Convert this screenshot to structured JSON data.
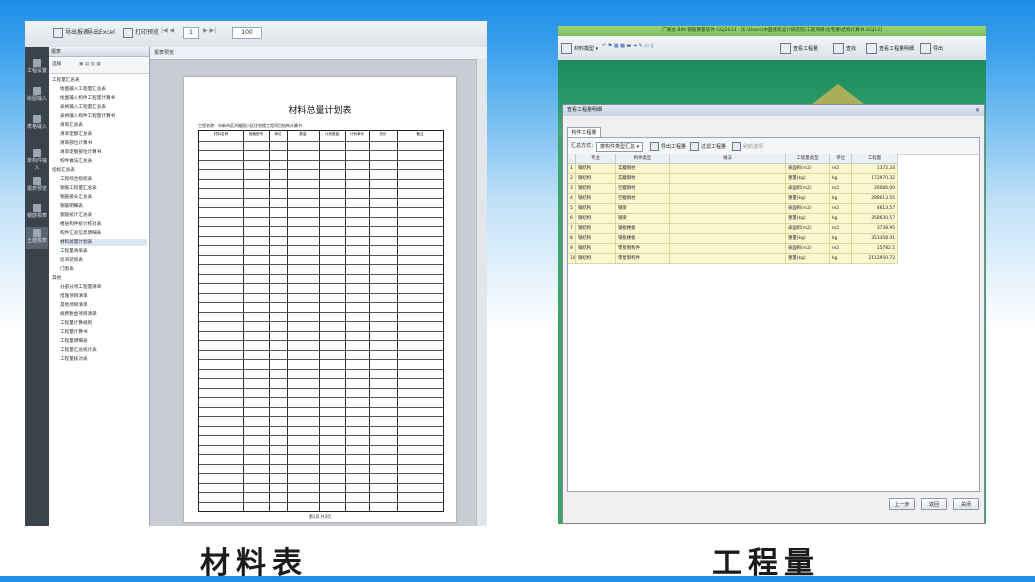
{
  "left": {
    "toolbar": {
      "item1": "导出报表",
      "item2": "导出Excel",
      "item3": "打印预览",
      "page_input": "1",
      "zoom_input": "100"
    },
    "rail": [
      "工程设置",
      "绘图输入",
      "表格输入",
      "单构件输入",
      "报表预览",
      "钢筋报表",
      "土建报表"
    ],
    "tree": {
      "header": "报表",
      "toolbar_label": "选择",
      "lines": [
        "工程量汇总表",
        "绘图输入工程量汇总表",
        "绘图输入构件工程量计算书",
        "表格输入工程量汇总表",
        "表格输入构件工程量计算书",
        "清单汇总表",
        "清单定额汇总表",
        "清单部位计算书",
        "清单定额部位计算书",
        "构件做法汇总表",
        "指标汇总表",
        "工程综合指标表",
        "钢筋工程量汇总表",
        "钢筋接头汇总表",
        "钢筋明细表",
        "钢筋统计汇总表",
        "楼层构件统计校对表",
        "构件汇总信息明细表",
        "材料总量计划表",
        "工程量清单表",
        "房间装修表",
        "门窗表",
        "其他",
        "分部分项工程量清单",
        "措施项目清单",
        "其他项目清单",
        "规费税金项目清单",
        "工程量计算规则",
        "工程量计算书",
        "工程量明细表",
        "工程量汇总统计表",
        "工程量核对表"
      ]
    },
    "main_tab": "报表预览",
    "document": {
      "title": "材料总量计划表",
      "project_line": "工程名称：市新市区洪福园小区住宅楼工程项目结构计算书",
      "headers": [
        "材料名称",
        "规格型号",
        "单位",
        "数量",
        "计划数量",
        "计划单价",
        "总价",
        "备注"
      ],
      "page_label": "第1页 共3页"
    },
    "caption": "材料表"
  },
  "right": {
    "app_title": "广联达 BIM 钢筋算量软件 GGJ2013 - [E:\\Users\\中国建筑设计研究院\\工程项目\\住宅楼\\结构计算书.GGJ12]",
    "toolbar": {
      "model": "材料模型",
      "export_label": "查看工程量",
      "find_label": "查找",
      "engineering_qty": "查看工程量明细",
      "export2": "导出"
    },
    "dialog": {
      "title": "查看工程量明细",
      "tab": "构件工程量",
      "summary_label": "汇总方式：",
      "summary_value": "按构件类型汇总",
      "btn_export": "导出工程量",
      "btn_filter": "过滤工程量",
      "btn_refresh": "刷新选项",
      "columns": [
        "专业",
        "构件类型",
        "做法",
        "工程量类型",
        "单位",
        "工程量"
      ],
      "rows": [
        {
          "n": "1",
          "major": "钢结构",
          "type": "实腹钢柱",
          "method": "",
          "qty_type": "表面积(m2)",
          "unit": "m2",
          "value": "1372.24"
        },
        {
          "n": "2",
          "major": "钢结构",
          "type": "实腹钢柱",
          "method": "",
          "qty_type": "重量(kg)",
          "unit": "kg",
          "value": "172970.32"
        },
        {
          "n": "3",
          "major": "钢结构",
          "type": "空腹钢柱",
          "method": "",
          "qty_type": "表面积(m2)",
          "unit": "m2",
          "value": "26086.00"
        },
        {
          "n": "4",
          "major": "钢结构",
          "type": "空腹钢柱",
          "method": "",
          "qty_type": "重量(kg)",
          "unit": "kg",
          "value": "298013.55"
        },
        {
          "n": "5",
          "major": "钢结构",
          "type": "钢梁",
          "method": "",
          "qty_type": "表面积(m2)",
          "unit": "m2",
          "value": "4613.57"
        },
        {
          "n": "6",
          "major": "钢结构",
          "type": "钢梁",
          "method": "",
          "qty_type": "重量(kg)",
          "unit": "kg",
          "value": "358630.57"
        },
        {
          "n": "7",
          "major": "钢结构",
          "type": "钢板楼板",
          "method": "",
          "qty_type": "表面积(m2)",
          "unit": "m2",
          "value": "3738.95"
        },
        {
          "n": "8",
          "major": "钢结构",
          "type": "钢板楼板",
          "method": "",
          "qty_type": "重量(kg)",
          "unit": "kg",
          "value": "353358.41"
        },
        {
          "n": "9",
          "major": "钢结构",
          "type": "零星钢构件",
          "method": "",
          "qty_type": "表面积(m2)",
          "unit": "m2",
          "value": "15782.5"
        },
        {
          "n": "10",
          "major": "钢结构",
          "type": "零星钢构件",
          "method": "",
          "qty_type": "重量(kg)",
          "unit": "kg",
          "value": "2112950.72"
        }
      ],
      "btn_prev": "上一步",
      "btn_ok": "返回",
      "btn_close": "关闭"
    },
    "caption": "工程量"
  }
}
